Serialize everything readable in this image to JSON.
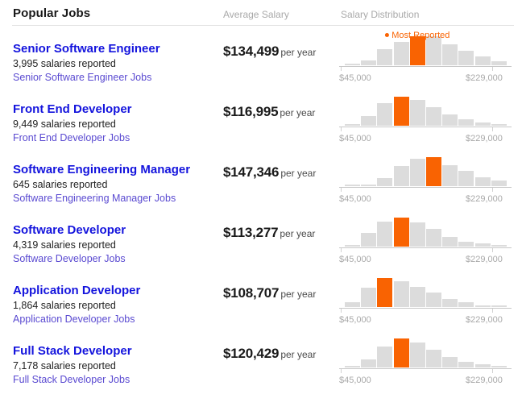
{
  "header": {
    "title": "Popular Jobs",
    "col_average_salary": "Average Salary",
    "col_salary_distribution": "Salary Distribution"
  },
  "legend": {
    "most_reported_label": "Most Reported",
    "most_reported_color": "#f96302",
    "bar_color": "#dcdcdc"
  },
  "axis": {
    "min_label": "$45,000",
    "max_label": "$229,000"
  },
  "jobs": [
    {
      "title": "Senior Software Engineer",
      "salaries_reported": "3,995 salaries reported",
      "jobs_link": "Senior Software Engineer Jobs",
      "average_salary": "$134,499",
      "period": "per year"
    },
    {
      "title": "Front End Developer",
      "salaries_reported": "9,449 salaries reported",
      "jobs_link": "Front End Developer Jobs",
      "average_salary": "$116,995",
      "period": "per year"
    },
    {
      "title": "Software Engineering Manager",
      "salaries_reported": "645 salaries reported",
      "jobs_link": "Software Engineering Manager Jobs",
      "average_salary": "$147,346",
      "period": "per year"
    },
    {
      "title": "Software Developer",
      "salaries_reported": "4,319 salaries reported",
      "jobs_link": "Software Developer Jobs",
      "average_salary": "$113,277",
      "period": "per year"
    },
    {
      "title": "Application Developer",
      "salaries_reported": "1,864 salaries reported",
      "jobs_link": "Application Developer Jobs",
      "average_salary": "$108,707",
      "period": "per year"
    },
    {
      "title": "Full Stack Developer",
      "salaries_reported": "7,178 salaries reported",
      "jobs_link": "Full Stack Developer Jobs",
      "average_salary": "$120,429",
      "period": "per year"
    }
  ],
  "chart_data": [
    {
      "type": "bar",
      "title": "Senior Software Engineer salary distribution",
      "xlabel": "",
      "ylabel": "",
      "grid": false,
      "legend_position": "above-peak",
      "x_axis_ticks": [
        "$45,000",
        "$229,000"
      ],
      "xlim": [
        45000,
        229000
      ],
      "categories": [
        "b1",
        "b2",
        "b3",
        "b4",
        "b5",
        "b6",
        "b7",
        "b8",
        "b9",
        "b10"
      ],
      "values": [
        1,
        5,
        17,
        24,
        30,
        30,
        22,
        15,
        9,
        4
      ],
      "ylim": [
        0,
        30
      ],
      "peak_index": 4,
      "peak_label": "Most Reported"
    },
    {
      "type": "bar",
      "title": "Front End Developer salary distribution",
      "xlabel": "",
      "ylabel": "",
      "grid": false,
      "legend_position": "above-peak",
      "x_axis_ticks": [
        "$45,000",
        "$229,000"
      ],
      "xlim": [
        45000,
        229000
      ],
      "categories": [
        "b1",
        "b2",
        "b3",
        "b4",
        "b5",
        "b6",
        "b7",
        "b8",
        "b9",
        "b10"
      ],
      "values": [
        1,
        10,
        23,
        30,
        27,
        19,
        12,
        7,
        3,
        1
      ],
      "ylim": [
        0,
        30
      ],
      "peak_index": 3,
      "peak_label": "Most Reported"
    },
    {
      "type": "bar",
      "title": "Software Engineering Manager salary distribution",
      "xlabel": "",
      "ylabel": "",
      "grid": false,
      "legend_position": "above-peak",
      "x_axis_ticks": [
        "$45,000",
        "$229,000"
      ],
      "xlim": [
        45000,
        229000
      ],
      "categories": [
        "b1",
        "b2",
        "b3",
        "b4",
        "b5",
        "b6",
        "b7",
        "b8",
        "b9",
        "b10"
      ],
      "values": [
        1,
        2,
        8,
        21,
        28,
        30,
        22,
        16,
        9,
        6
      ],
      "ylim": [
        0,
        30
      ],
      "peak_index": 5,
      "peak_label": "Most Reported"
    },
    {
      "type": "bar",
      "title": "Software Developer salary distribution",
      "xlabel": "",
      "ylabel": "",
      "grid": false,
      "legend_position": "above-peak",
      "x_axis_ticks": [
        "$45,000",
        "$229,000"
      ],
      "xlim": [
        45000,
        229000
      ],
      "categories": [
        "b1",
        "b2",
        "b3",
        "b4",
        "b5",
        "b6",
        "b7",
        "b8",
        "b9",
        "b10"
      ],
      "values": [
        2,
        14,
        26,
        30,
        25,
        18,
        10,
        5,
        3,
        1
      ],
      "ylim": [
        0,
        30
      ],
      "peak_index": 3,
      "peak_label": "Most Reported"
    },
    {
      "type": "bar",
      "title": "Application Developer salary distribution",
      "xlabel": "",
      "ylabel": "",
      "grid": false,
      "legend_position": "above-peak",
      "x_axis_ticks": [
        "$45,000",
        "$229,000"
      ],
      "xlim": [
        45000,
        229000
      ],
      "categories": [
        "b1",
        "b2",
        "b3",
        "b4",
        "b5",
        "b6",
        "b7",
        "b8",
        "b9",
        "b10"
      ],
      "values": [
        5,
        20,
        30,
        27,
        21,
        15,
        8,
        5,
        2,
        1
      ],
      "ylim": [
        0,
        30
      ],
      "peak_index": 2,
      "peak_label": "Most Reported"
    },
    {
      "type": "bar",
      "title": "Full Stack Developer salary distribution",
      "xlabel": "",
      "ylabel": "",
      "grid": false,
      "legend_position": "above-peak",
      "x_axis_ticks": [
        "$45,000",
        "$229,000"
      ],
      "xlim": [
        45000,
        229000
      ],
      "categories": [
        "b1",
        "b2",
        "b3",
        "b4",
        "b5",
        "b6",
        "b7",
        "b8",
        "b9",
        "b10"
      ],
      "values": [
        1,
        8,
        22,
        30,
        26,
        18,
        11,
        6,
        3,
        1
      ],
      "ylim": [
        0,
        30
      ],
      "peak_index": 3,
      "peak_label": "Most Reported"
    }
  ]
}
